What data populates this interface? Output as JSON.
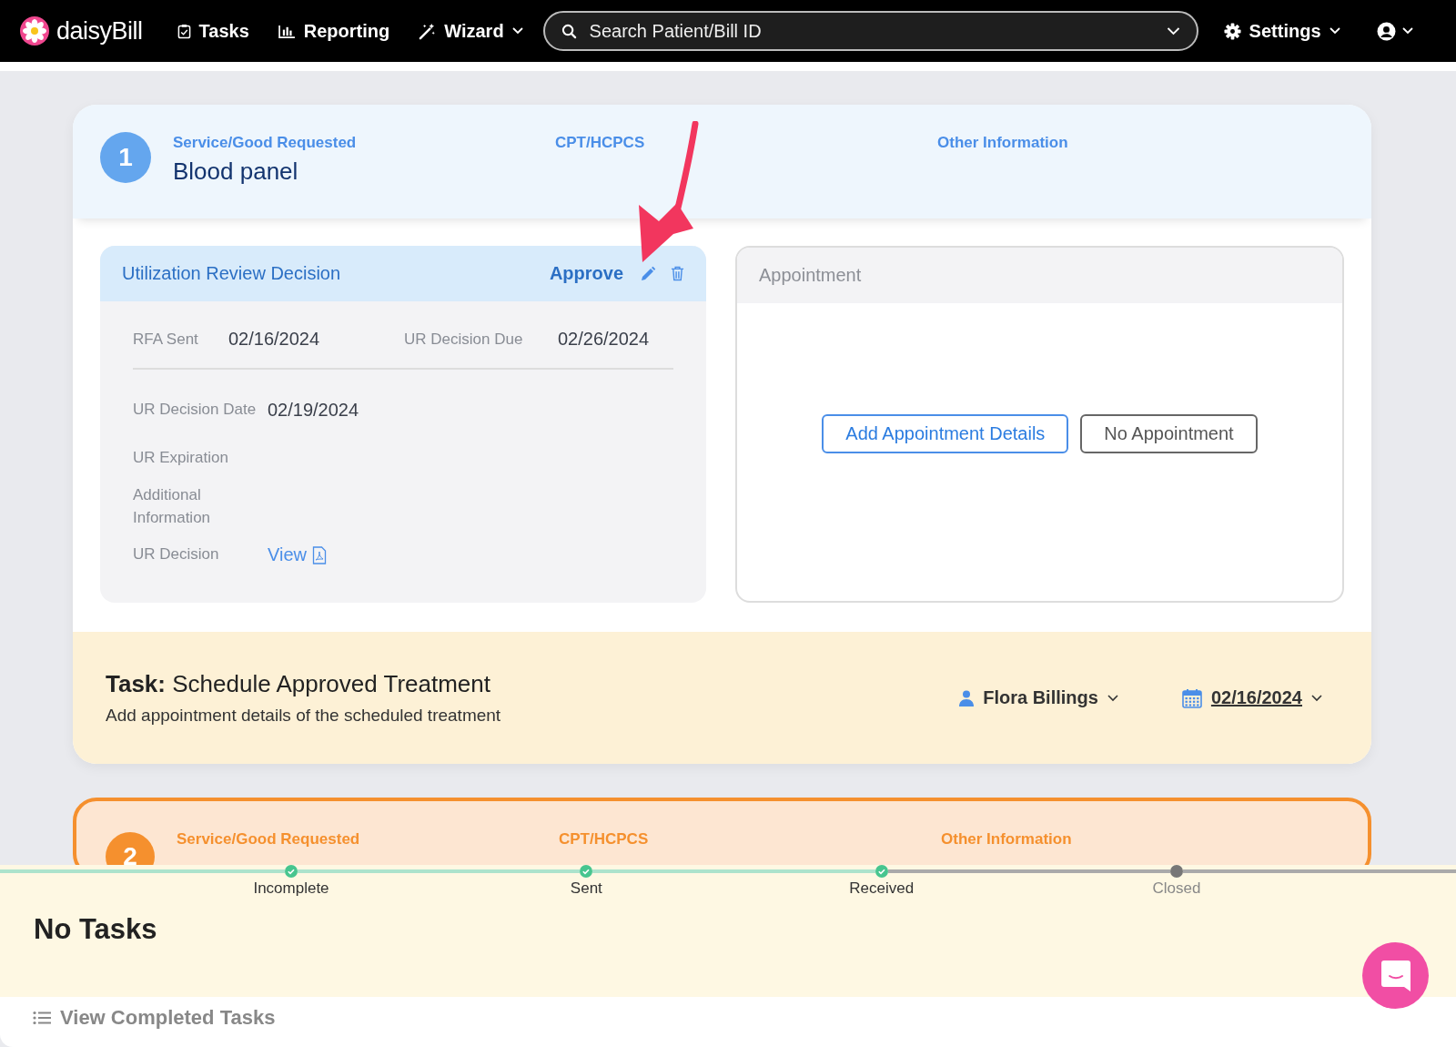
{
  "navbar": {
    "brand": "daisyBill",
    "items": [
      {
        "label": "Tasks",
        "kind": "tasks"
      },
      {
        "label": "Reporting",
        "kind": "reporting"
      },
      {
        "label": "Wizard",
        "kind": "wizard"
      }
    ],
    "search": {
      "placeholder": "Search Patient/Bill ID"
    },
    "settings": "Settings"
  },
  "requests": [
    {
      "number": "1",
      "highlighted": false,
      "service_label": "Service/Good Requested",
      "service": "Blood panel",
      "cpt_label": "CPT/HCPCS",
      "other_label": "Other Information",
      "ur": {
        "title": "Utilization Review Decision",
        "decision": "Approve",
        "rfa_label": "RFA Sent",
        "rfa": "02/16/2024",
        "due_label": "UR Decision Due",
        "due": "02/26/2024",
        "fields": [
          {
            "label": "UR Decision Date",
            "value": "02/19/2024",
            "kind": "text"
          },
          {
            "label": "UR Expiration",
            "kind": "text"
          },
          {
            "label": "Additional Information",
            "kind": "text"
          },
          {
            "label": "UR Decision",
            "value": "View",
            "kind": "link"
          }
        ]
      },
      "appointment": {
        "title": "Appointment",
        "buttons": [
          {
            "label": "Add Appointment Details",
            "kind": "primary"
          },
          {
            "label": "No Appointment",
            "kind": "secondary"
          }
        ]
      },
      "task": {
        "label": "Task:",
        "title": "Schedule Approved Treatment",
        "description": "Add appointment details of the scheduled treatment",
        "assignee": "Flora Billings",
        "date": "02/16/2024"
      }
    },
    {
      "number": "2",
      "highlighted": true,
      "service_label": "Service/Good Requested",
      "cpt_label": "CPT/HCPCS",
      "other_label": "Other Information"
    }
  ],
  "tasks_panel": {
    "steps": [
      {
        "label": "Incomplete",
        "done": true
      },
      {
        "label": "Sent",
        "done": true
      },
      {
        "label": "Received",
        "done": true
      },
      {
        "label": "Closed",
        "done": false
      }
    ],
    "title": "No Tasks",
    "link": "View Completed Tasks"
  }
}
